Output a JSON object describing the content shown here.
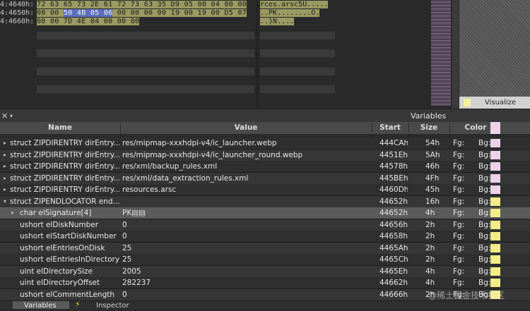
{
  "hex": {
    "rows": [
      {
        "addr": "4:4640h:",
        "pre": "72 63 65 73 2E 61 72 73 63 35 D9 05 00 04 00 00",
        "hl": "",
        "post": "",
        "ascii": "rces.arsc5Ù....."
      },
      {
        "addr": "4:4650h:",
        "pre": "00 00 ",
        "hl": "50 4B 05 06",
        "post": " 00 00 00 00 19 00 19 00 D5 07",
        "ascii": "..PK........Õ."
      },
      {
        "addr": "4:4660h:",
        "pre": "00 00 7D 4E 04 00 00 00",
        "hl": "",
        "post": "",
        "ascii": "..}N...."
      }
    ],
    "visualize_label": "Visualize"
  },
  "panel": {
    "title": "Variables",
    "close_glyph": "✕",
    "menu_glyph": "▾"
  },
  "columns": {
    "name": "Name",
    "value": "Value",
    "start": "Start",
    "size": "Size",
    "color": "Color"
  },
  "rows": [
    {
      "name": "struct ZIPDIRENTRY dirEntry...",
      "value": "res/mipmap-xxxhdpi-v4/ic_launcher.webp",
      "start": "444CAh",
      "size": "54h",
      "fg": "Fg:",
      "bg": "Bg:",
      "color": "#ecd3ea",
      "arrow": "▸",
      "indent": 0
    },
    {
      "name": "struct ZIPDIRENTRY dirEntry...",
      "value": "res/mipmap-xxxhdpi-v4/ic_launcher_round.webp",
      "start": "4451Eh",
      "size": "5Ah",
      "fg": "Fg:",
      "bg": "Bg:",
      "color": "#ecd3ea",
      "arrow": "▸",
      "indent": 0
    },
    {
      "name": "struct ZIPDIRENTRY dirEntry...",
      "value": "res/xml/backup_rules.xml",
      "start": "44578h",
      "size": "46h",
      "fg": "Fg:",
      "bg": "Bg:",
      "color": "#ecd3ea",
      "arrow": "▸",
      "indent": 0
    },
    {
      "name": "struct ZIPDIRENTRY dirEntry...",
      "value": "res/xml/data_extraction_rules.xml",
      "start": "445BEh",
      "size": "4Fh",
      "fg": "Fg:",
      "bg": "Bg:",
      "color": "#ecd3ea",
      "arrow": "▸",
      "indent": 0
    },
    {
      "name": "struct ZIPDIRENTRY dirEntry...",
      "value": "resources.arsc",
      "start": "4460Dh",
      "size": "45h",
      "fg": "Fg:",
      "bg": "Bg:",
      "color": "#ecd3ea",
      "arrow": "▸",
      "indent": 0
    },
    {
      "name": "struct ZIPENDLOCATOR end...",
      "value": "",
      "start": "44652h",
      "size": "16h",
      "fg": "Fg:",
      "bg": "Bg:",
      "color": "#f2ec8a",
      "arrow": "▾",
      "indent": 0
    },
    {
      "name": "char elSignature[4]",
      "value": "PK▤▤",
      "start": "44652h",
      "size": "4h",
      "fg": "Fg:",
      "bg": "Bg:",
      "color": "#f2ec8a",
      "arrow": "▸",
      "indent": 1
    },
    {
      "name": "ushort elDiskNumber",
      "value": "0",
      "start": "44656h",
      "size": "2h",
      "fg": "Fg:",
      "bg": "Bg:",
      "color": "#f2ec8a",
      "arrow": "",
      "indent": 1
    },
    {
      "name": "ushort elStartDiskNumber",
      "value": "0",
      "start": "44658h",
      "size": "2h",
      "fg": "Fg:",
      "bg": "Bg:",
      "color": "#f2ec8a",
      "arrow": "",
      "indent": 1
    },
    {
      "name": "ushort elEntriesOnDisk",
      "value": "25",
      "start": "4465Ah",
      "size": "2h",
      "fg": "Fg:",
      "bg": "Bg:",
      "color": "#f2ec8a",
      "arrow": "",
      "indent": 1
    },
    {
      "name": "ushort elEntriesInDirectory",
      "value": "25",
      "start": "4465Ch",
      "size": "2h",
      "fg": "Fg:",
      "bg": "Bg:",
      "color": "#f2ec8a",
      "arrow": "",
      "indent": 1
    },
    {
      "name": "uint elDirectorySize",
      "value": "2005",
      "start": "4465Eh",
      "size": "4h",
      "fg": "Fg:",
      "bg": "Bg:",
      "color": "#f2ec8a",
      "arrow": "",
      "indent": 1
    },
    {
      "name": "uint elDirectoryOffset",
      "value": "282237",
      "start": "44662h",
      "size": "4h",
      "fg": "Fg:",
      "bg": "Bg:",
      "color": "#f2ec8a",
      "arrow": "",
      "indent": 1
    },
    {
      "name": "ushort elCommentLength",
      "value": "0",
      "start": "44666h",
      "size": "2h",
      "fg": "Fg:",
      "bg": "Bg:",
      "color": "#f2ec8a",
      "arrow": "",
      "indent": 1
    }
  ],
  "tabs": {
    "variables": "Variables",
    "inspector": "Inspector",
    "bolt_glyph": "⚡"
  },
  "watermark": "@稀土掘金技术社区",
  "colors": {
    "selected_row": "#5b5b5b",
    "row_even": "#2f2f2f",
    "row_odd": "#363636"
  }
}
